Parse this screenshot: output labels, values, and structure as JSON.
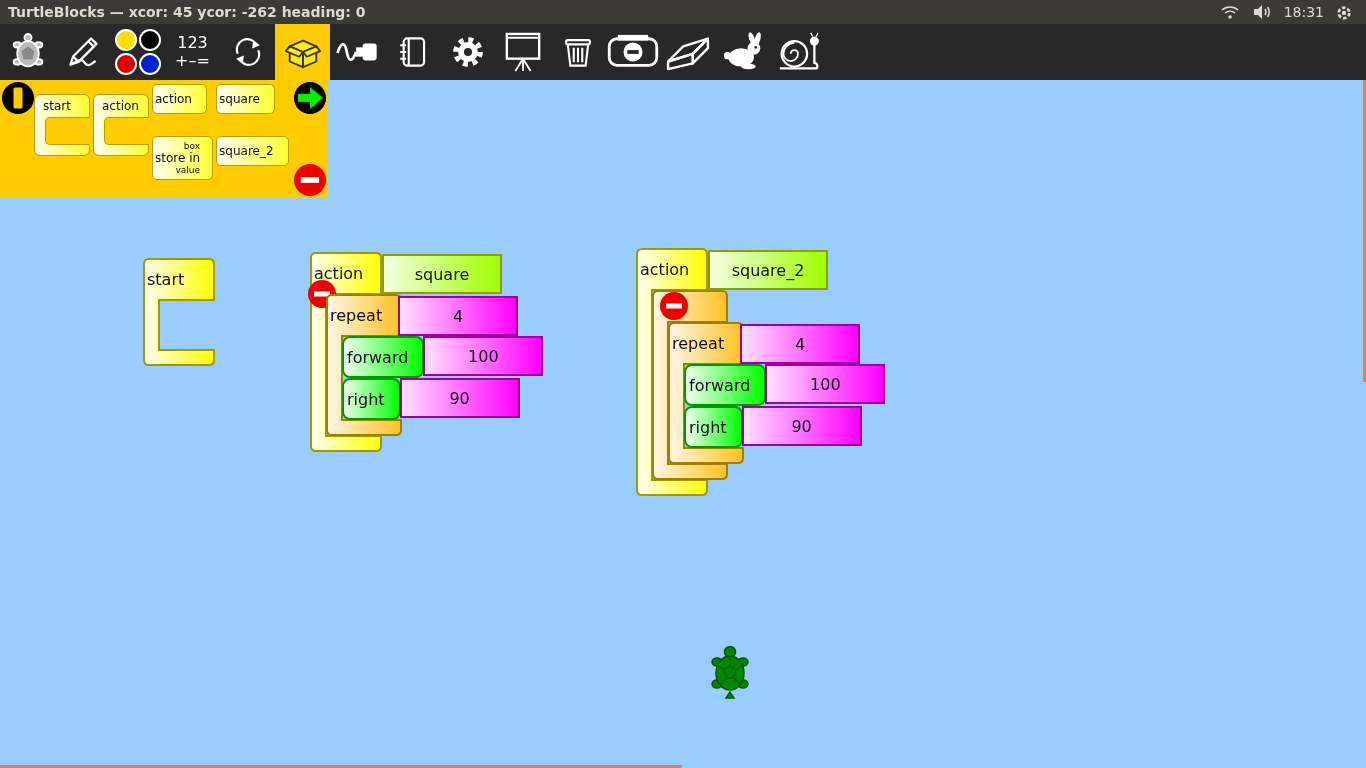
{
  "title_bar": {
    "title": "TurtleBlocks — xcor: 45 ycor: -262 heading: 0",
    "time": "18:31"
  },
  "toolbar": {
    "items": [
      {
        "kind": "turtle",
        "selected": false
      },
      {
        "kind": "pen",
        "selected": false
      },
      {
        "kind": "colors",
        "selected": false
      },
      {
        "kind": "numbers",
        "lines": [
          "123",
          "+–="
        ],
        "selected": false
      },
      {
        "kind": "flow",
        "selected": false
      },
      {
        "kind": "blocks",
        "selected": true
      },
      {
        "kind": "sensors",
        "selected": false
      },
      {
        "kind": "extras",
        "selected": false
      },
      {
        "kind": "settings",
        "selected": false
      },
      {
        "kind": "presentation",
        "selected": false
      },
      {
        "kind": "trash",
        "selected": false
      },
      {
        "kind": "collapse",
        "selected": false
      },
      {
        "kind": "eraser",
        "selected": false
      },
      {
        "kind": "rabbit",
        "selected": false
      },
      {
        "kind": "snail",
        "selected": false
      }
    ]
  },
  "palette": {
    "blocks": [
      {
        "kind": "hat",
        "label": "start"
      },
      {
        "kind": "hat",
        "label": "action"
      },
      {
        "kind": "command",
        "label": "action"
      },
      {
        "kind": "store",
        "label": "store in",
        "slots": [
          "box",
          "value"
        ]
      },
      {
        "kind": "command",
        "label": "square"
      },
      {
        "kind": "command",
        "label": "square_2"
      }
    ]
  },
  "canvas": {
    "stacks": [
      {
        "kind": "hat",
        "label": "start",
        "collapsible": false
      },
      {
        "kind": "hat",
        "label": "action",
        "collapsible": true,
        "arg": {
          "kind": "name",
          "text": "square"
        },
        "children": [
          {
            "kind": "clamp",
            "label": "repeat",
            "collapsible": false,
            "arg": {
              "kind": "number",
              "text": "4"
            },
            "children": [
              {
                "kind": "command",
                "label": "forward",
                "arg": {
                  "kind": "number",
                  "text": "100"
                }
              },
              {
                "kind": "command",
                "label": "right",
                "arg": {
                  "kind": "number",
                  "text": "90"
                }
              }
            ]
          }
        ]
      },
      {
        "kind": "hat",
        "label": "action",
        "collapsible": false,
        "arg": {
          "kind": "name",
          "text": "square_2"
        },
        "children": [
          {
            "kind": "clamp",
            "collapsible": true,
            "children": [
              {
                "kind": "clamp",
                "label": "repeat",
                "collapsible": false,
                "arg": {
                  "kind": "number",
                  "text": "4"
                },
                "children": [
                  {
                    "kind": "command",
                    "label": "forward",
                    "arg": {
                      "kind": "number",
                      "text": "100"
                    }
                  },
                  {
                    "kind": "command",
                    "label": "right",
                    "arg": {
                      "kind": "number",
                      "text": "90"
                    }
                  }
                ]
              }
            ]
          }
        ]
      }
    ]
  }
}
